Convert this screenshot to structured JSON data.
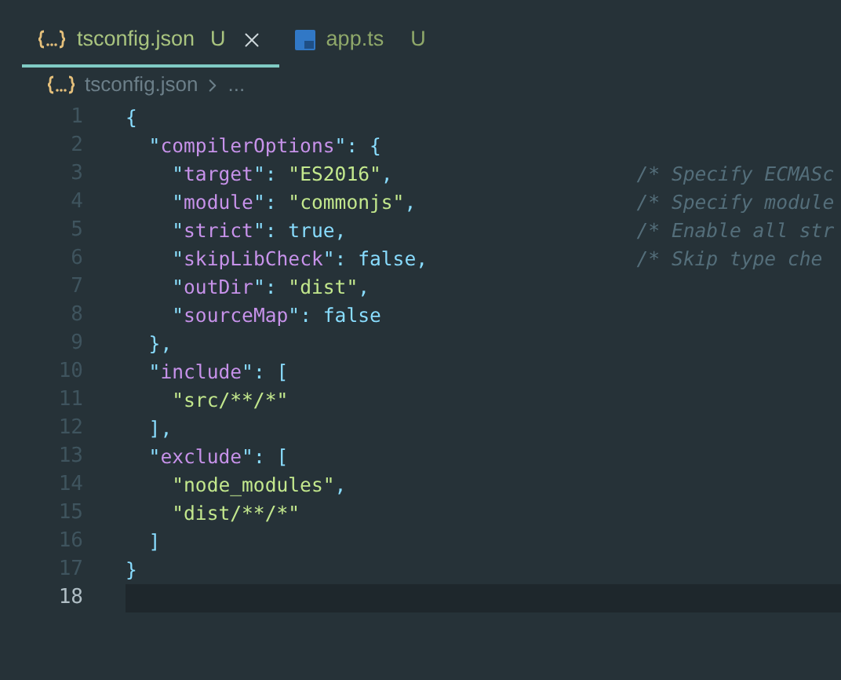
{
  "tabs": [
    {
      "label": "tsconfig.json",
      "status": "U",
      "kind": "json",
      "selected": true
    },
    {
      "label": "app.ts",
      "status": "U",
      "kind": "ts",
      "selected": false
    }
  ],
  "breadcrumb": {
    "file": "tsconfig.json",
    "more": "..."
  },
  "lines": [
    {
      "number": "1",
      "current": false,
      "tokens": [
        {
          "kind": "p",
          "text": "{"
        }
      ]
    },
    {
      "number": "2",
      "current": false,
      "tokens": [
        {
          "kind": "p",
          "text": "  \""
        },
        {
          "kind": "key",
          "text": "compilerOptions"
        },
        {
          "kind": "p",
          "text": "\": {"
        }
      ]
    },
    {
      "number": "3",
      "current": false,
      "tokens": [
        {
          "kind": "p",
          "text": "    \""
        },
        {
          "kind": "key",
          "text": "target"
        },
        {
          "kind": "p",
          "text": "\": "
        },
        {
          "kind": "str",
          "text": "\"ES2016\""
        },
        {
          "kind": "p",
          "text": ","
        }
      ],
      "comment": "/* Specify ECMASc"
    },
    {
      "number": "4",
      "current": false,
      "tokens": [
        {
          "kind": "p",
          "text": "    \""
        },
        {
          "kind": "key",
          "text": "module"
        },
        {
          "kind": "p",
          "text": "\": "
        },
        {
          "kind": "str",
          "text": "\"commonjs\""
        },
        {
          "kind": "p",
          "text": ","
        }
      ],
      "comment": "/* Specify module"
    },
    {
      "number": "5",
      "current": false,
      "tokens": [
        {
          "kind": "p",
          "text": "    \""
        },
        {
          "kind": "key",
          "text": "strict"
        },
        {
          "kind": "p",
          "text": "\": "
        },
        {
          "kind": "bool",
          "text": "true"
        },
        {
          "kind": "p",
          "text": ","
        }
      ],
      "comment": "/* Enable all str"
    },
    {
      "number": "6",
      "current": false,
      "tokens": [
        {
          "kind": "p",
          "text": "    \""
        },
        {
          "kind": "key",
          "text": "skipLibCheck"
        },
        {
          "kind": "p",
          "text": "\": "
        },
        {
          "kind": "bool",
          "text": "false"
        },
        {
          "kind": "p",
          "text": ","
        }
      ],
      "comment": "/* Skip type che"
    },
    {
      "number": "7",
      "current": false,
      "tokens": [
        {
          "kind": "p",
          "text": "    \""
        },
        {
          "kind": "key",
          "text": "outDir"
        },
        {
          "kind": "p",
          "text": "\": "
        },
        {
          "kind": "str",
          "text": "\"dist\""
        },
        {
          "kind": "p",
          "text": ","
        }
      ]
    },
    {
      "number": "8",
      "current": false,
      "tokens": [
        {
          "kind": "p",
          "text": "    \""
        },
        {
          "kind": "key",
          "text": "sourceMap"
        },
        {
          "kind": "p",
          "text": "\": "
        },
        {
          "kind": "bool",
          "text": "false"
        }
      ]
    },
    {
      "number": "9",
      "current": false,
      "tokens": [
        {
          "kind": "p",
          "text": "  },"
        }
      ]
    },
    {
      "number": "10",
      "current": false,
      "tokens": [
        {
          "kind": "p",
          "text": "  \""
        },
        {
          "kind": "key",
          "text": "include"
        },
        {
          "kind": "p",
          "text": "\": ["
        }
      ]
    },
    {
      "number": "11",
      "current": false,
      "tokens": [
        {
          "kind": "str",
          "text": "    \"src/**/*\""
        }
      ]
    },
    {
      "number": "12",
      "current": false,
      "tokens": [
        {
          "kind": "p",
          "text": "  ],"
        }
      ]
    },
    {
      "number": "13",
      "current": false,
      "tokens": [
        {
          "kind": "p",
          "text": "  \""
        },
        {
          "kind": "key",
          "text": "exclude"
        },
        {
          "kind": "p",
          "text": "\": ["
        }
      ]
    },
    {
      "number": "14",
      "current": false,
      "tokens": [
        {
          "kind": "str",
          "text": "    \"node_modules\""
        },
        {
          "kind": "p",
          "text": ","
        }
      ]
    },
    {
      "number": "15",
      "current": false,
      "tokens": [
        {
          "kind": "str",
          "text": "    \"dist/**/*\""
        }
      ]
    },
    {
      "number": "16",
      "current": false,
      "tokens": [
        {
          "kind": "p",
          "text": "  ]"
        }
      ]
    },
    {
      "number": "17",
      "current": false,
      "tokens": [
        {
          "kind": "p",
          "text": "}"
        }
      ]
    },
    {
      "number": "18",
      "current": true
    }
  ]
}
